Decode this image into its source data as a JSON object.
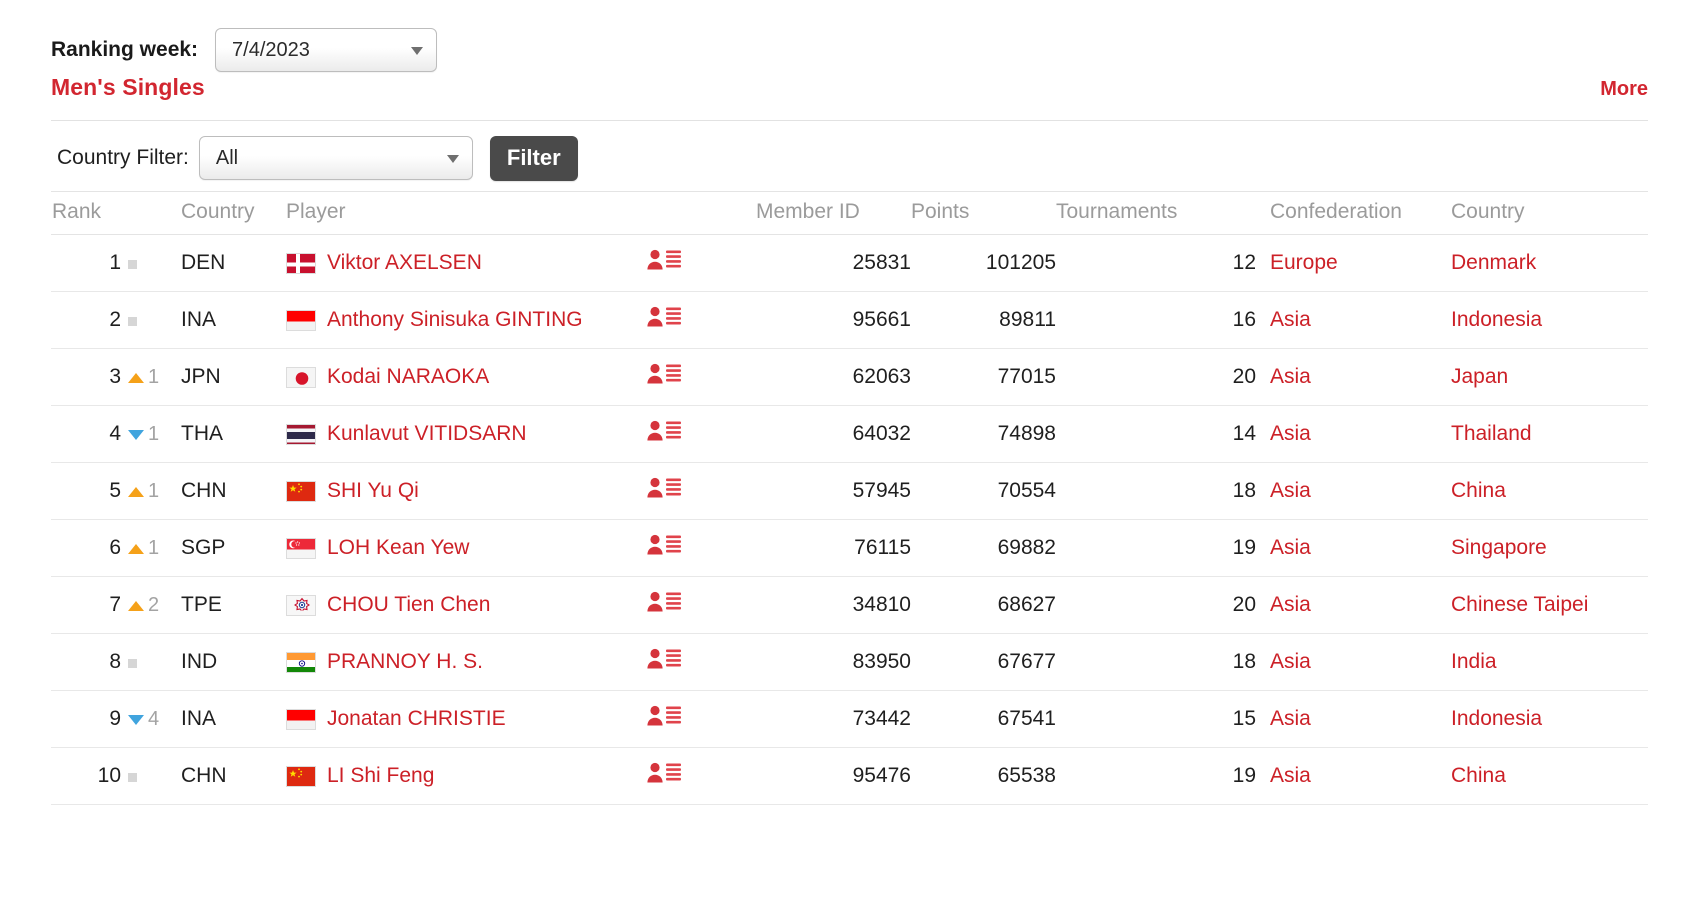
{
  "filters": {
    "week_label": "Ranking week:",
    "week_value": "7/4/2023",
    "country_label": "Country Filter:",
    "country_value": "All",
    "filter_button": "Filter"
  },
  "section": {
    "title": "Men's Singles",
    "more": "More"
  },
  "colors": {
    "accent_red": "#cc2027",
    "heading_red": "#d22630",
    "up_arrow": "#f5a119",
    "down_arrow": "#40a4de",
    "no_change": "#d6d6d6",
    "button_dark": "#4a4a4a",
    "header_grey": "#9b9b9b"
  },
  "table": {
    "columns": [
      "Rank",
      "",
      "Country",
      "Player",
      "",
      "Member ID",
      "Points",
      "Tournaments",
      "Confederation",
      "Country"
    ],
    "headers": {
      "rank": "Rank",
      "country_code": "Country",
      "player": "Player",
      "member_id": "Member ID",
      "points": "Points",
      "tournaments": "Tournaments",
      "confederation": "Confederation",
      "country": "Country"
    },
    "rows": [
      {
        "rank": "1",
        "move": "same",
        "move_value": "",
        "code": "DEN",
        "flag": "denmark-flag",
        "player": "Viktor AXELSEN",
        "icon": "player-profile-icon",
        "member_id": "25831",
        "points": "101205",
        "tournaments": "12",
        "confederation": "Europe",
        "country": "Denmark"
      },
      {
        "rank": "2",
        "move": "same",
        "move_value": "",
        "code": "INA",
        "flag": "indonesia-flag",
        "player": "Anthony Sinisuka GINTING",
        "icon": "player-profile-icon",
        "member_id": "95661",
        "points": "89811",
        "tournaments": "16",
        "confederation": "Asia",
        "country": "Indonesia"
      },
      {
        "rank": "3",
        "move": "up",
        "move_value": "1",
        "code": "JPN",
        "flag": "japan-flag",
        "player": "Kodai NARAOKA",
        "icon": "player-profile-icon",
        "member_id": "62063",
        "points": "77015",
        "tournaments": "20",
        "confederation": "Asia",
        "country": "Japan"
      },
      {
        "rank": "4",
        "move": "down",
        "move_value": "1",
        "code": "THA",
        "flag": "thailand-flag",
        "player": "Kunlavut VITIDSARN",
        "icon": "player-profile-icon",
        "member_id": "64032",
        "points": "74898",
        "tournaments": "14",
        "confederation": "Asia",
        "country": "Thailand"
      },
      {
        "rank": "5",
        "move": "up",
        "move_value": "1",
        "code": "CHN",
        "flag": "china-flag",
        "player": "SHI Yu Qi",
        "icon": "player-profile-icon",
        "member_id": "57945",
        "points": "70554",
        "tournaments": "18",
        "confederation": "Asia",
        "country": "China"
      },
      {
        "rank": "6",
        "move": "up",
        "move_value": "1",
        "code": "SGP",
        "flag": "singapore-flag",
        "player": "LOH Kean Yew",
        "icon": "player-profile-icon",
        "member_id": "76115",
        "points": "69882",
        "tournaments": "19",
        "confederation": "Asia",
        "country": "Singapore"
      },
      {
        "rank": "7",
        "move": "up",
        "move_value": "2",
        "code": "TPE",
        "flag": "chinese-taipei-flag",
        "player": "CHOU Tien Chen",
        "icon": "player-profile-icon",
        "member_id": "34810",
        "points": "68627",
        "tournaments": "20",
        "confederation": "Asia",
        "country": "Chinese Taipei"
      },
      {
        "rank": "8",
        "move": "same",
        "move_value": "",
        "code": "IND",
        "flag": "india-flag",
        "player": "PRANNOY H. S.",
        "icon": "player-profile-icon",
        "member_id": "83950",
        "points": "67677",
        "tournaments": "18",
        "confederation": "Asia",
        "country": "India"
      },
      {
        "rank": "9",
        "move": "down",
        "move_value": "4",
        "code": "INA",
        "flag": "indonesia-flag",
        "player": "Jonatan CHRISTIE",
        "icon": "player-profile-icon",
        "member_id": "73442",
        "points": "67541",
        "tournaments": "15",
        "confederation": "Asia",
        "country": "Indonesia"
      },
      {
        "rank": "10",
        "move": "same",
        "move_value": "",
        "code": "CHN",
        "flag": "china-flag",
        "player": "LI Shi Feng",
        "icon": "player-profile-icon",
        "member_id": "95476",
        "points": "65538",
        "tournaments": "19",
        "confederation": "Asia",
        "country": "China"
      }
    ]
  }
}
